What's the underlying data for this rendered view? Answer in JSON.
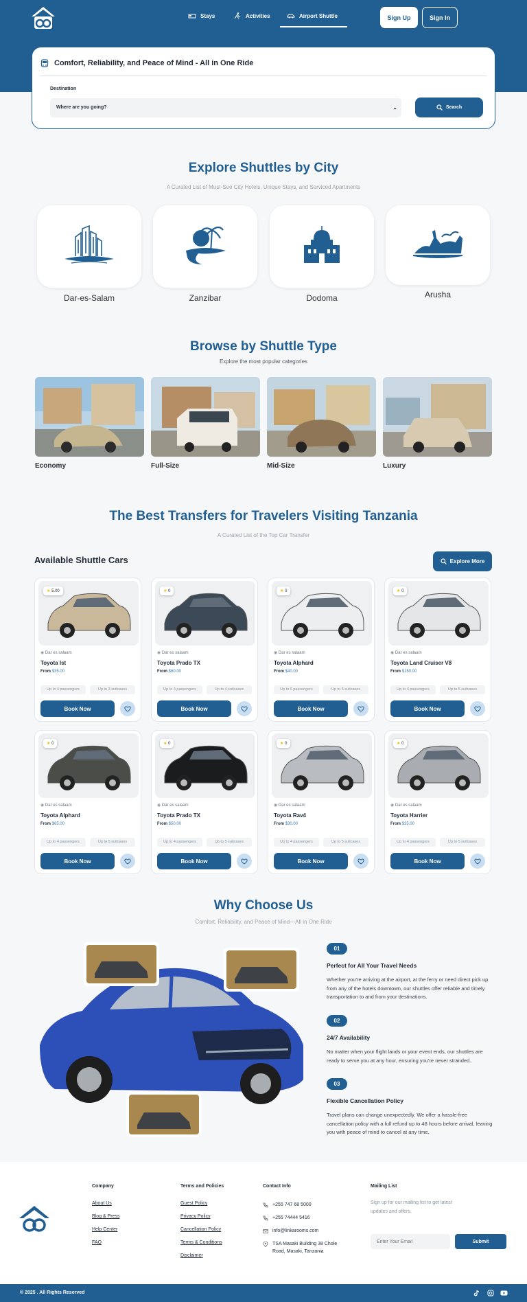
{
  "nav": {
    "items": [
      {
        "label": "Stays",
        "icon": "bed-icon"
      },
      {
        "label": "Activities",
        "icon": "person-running-icon"
      },
      {
        "label": "Airport Shuttle",
        "icon": "car-icon",
        "active": true
      }
    ],
    "signup_label": "Sign Up",
    "signin_label": "Sign In"
  },
  "search": {
    "title": "Comfort, Reliability, and Peace of Mind - All in One Ride",
    "destination_label": "Destination",
    "destination_value": "Where are you going?",
    "search_label": "Search"
  },
  "cities": {
    "title": "Explore Shuttles by City",
    "subtitle": "A Curated List of Must-See City Hotels, Unique Stays, and Serviced Apartments",
    "items": [
      "Dar-es-Salam",
      "Zanzibar",
      "Dodoma",
      "Arusha"
    ]
  },
  "types": {
    "title": "Browse by Shuttle Type",
    "subtitle": "Explore the most popular categories",
    "items": [
      "Economy",
      "Full-Size",
      "Mid-Size",
      "Luxury"
    ]
  },
  "transfers": {
    "title": "The Best Transfers for Travelers Visiting Tanzania",
    "subtitle": "A Curated List of the Top Car Transfer",
    "section_label": "Available Shuttle Cars",
    "explore_label": "Explore More",
    "from_label": "From",
    "book_label": "Book Now",
    "cars": [
      {
        "rating": "5.00",
        "location": "Dar es salaam",
        "name": "Toyota Ist",
        "price": "$35.00",
        "passengers": "Up to 4 passengers",
        "suitcases": "Up to 3 suitcases",
        "color": "#c9b89a"
      },
      {
        "rating": "0",
        "location": "Dar es salaam",
        "name": "Toyota Prado TX",
        "price": "$60.00",
        "passengers": "Up to 4 passengers",
        "suitcases": "Up to 4 suitcases",
        "color": "#3c4a57"
      },
      {
        "rating": "0",
        "location": "Dar es salaam",
        "name": "Toyota Alphard",
        "price": "$40.00",
        "passengers": "Up to 6 passengers",
        "suitcases": "Up to 5 suitcases",
        "color": "#eceef0"
      },
      {
        "rating": "0",
        "location": "Dar es salaam",
        "name": "Toyota Land Cruiser V8",
        "price": "$150.00",
        "passengers": "Up to 4 passengers",
        "suitcases": "Up to 5 suitcases",
        "color": "#e4e6e8"
      },
      {
        "rating": "0",
        "location": "Dar es salaam",
        "name": "Toyota Alphard",
        "price": "$65.00",
        "passengers": "Up to 4 passengers",
        "suitcases": "Up to 5 suitcases",
        "color": "#4a4d48"
      },
      {
        "rating": "0",
        "location": "Dar es salaam",
        "name": "Toyota Prado TX",
        "price": "$50.00",
        "passengers": "Up to 4 passengers",
        "suitcases": "Up to 5 suitcases",
        "color": "#1b1c1e"
      },
      {
        "rating": "0",
        "location": "Dar es salaam",
        "name": "Toyota Rav4",
        "price": "$30.00",
        "passengers": "Up to 4 passengers",
        "suitcases": "Up to 5 suitcases",
        "color": "#b9bdc1"
      },
      {
        "rating": "0",
        "location": "Dar es salaam",
        "name": "Toyota Harrier",
        "price": "$35.00",
        "passengers": "Up to 4 passengers",
        "suitcases": "Up to 5 suitcases",
        "color": "#a9adb2"
      }
    ]
  },
  "why": {
    "title": "Why Choose Us",
    "subtitle": "Comfort, Reliability, and Peace of Mind—All in One Ride",
    "steps": [
      {
        "num": "01",
        "title": "Perfect for All Your Travel Needs",
        "desc": "Whether you're arriving at the airport, at the ferry or need direct pick up from any of the hotels downtown, our shuttles offer reliable and timely transportation to and from your destinations."
      },
      {
        "num": "02",
        "title": "24/7 Availability",
        "desc": "No matter when your flight lands or your event ends, our shuttles are ready to serve you at any hour, ensuring you're never stranded."
      },
      {
        "num": "03",
        "title": "Flexible Cancellation Policy",
        "desc": "Travel plans can change unexpectedly. We offer a hassle-free cancellation policy with a full refund up to 48 hours before arrival, leaving you with peace of mind to cancel at any time."
      }
    ]
  },
  "footer": {
    "company": {
      "heading": "Company",
      "links": [
        "About Us",
        "Blog & Press",
        "Help Center",
        "FAQ"
      ]
    },
    "terms": {
      "heading": "Terms and Policies",
      "links": [
        "Guest Policy",
        "Privacy Policy",
        "Cancellation Policy",
        "Terms & Conditions",
        "Disclaimer"
      ]
    },
    "contact": {
      "heading": "Contact Info",
      "phone1": "+255 747 68 5000",
      "phone2": "+255 74444 5416",
      "email": "info@linkarooms.com",
      "address": "TSA Masaki Building 38 Chole Road, Masaki, Tanzania"
    },
    "mailing": {
      "heading": "Mailing List",
      "text": "Sign up for our mailing list to get latest updates and offers.",
      "placeholder": "Enter Your Email",
      "submit_label": "Submit"
    },
    "copyright": "© 2025 . All Rights Reserved"
  },
  "colors": {
    "primary": "#215f92",
    "light_blue": "#c9def0",
    "star": "#f5b400"
  }
}
